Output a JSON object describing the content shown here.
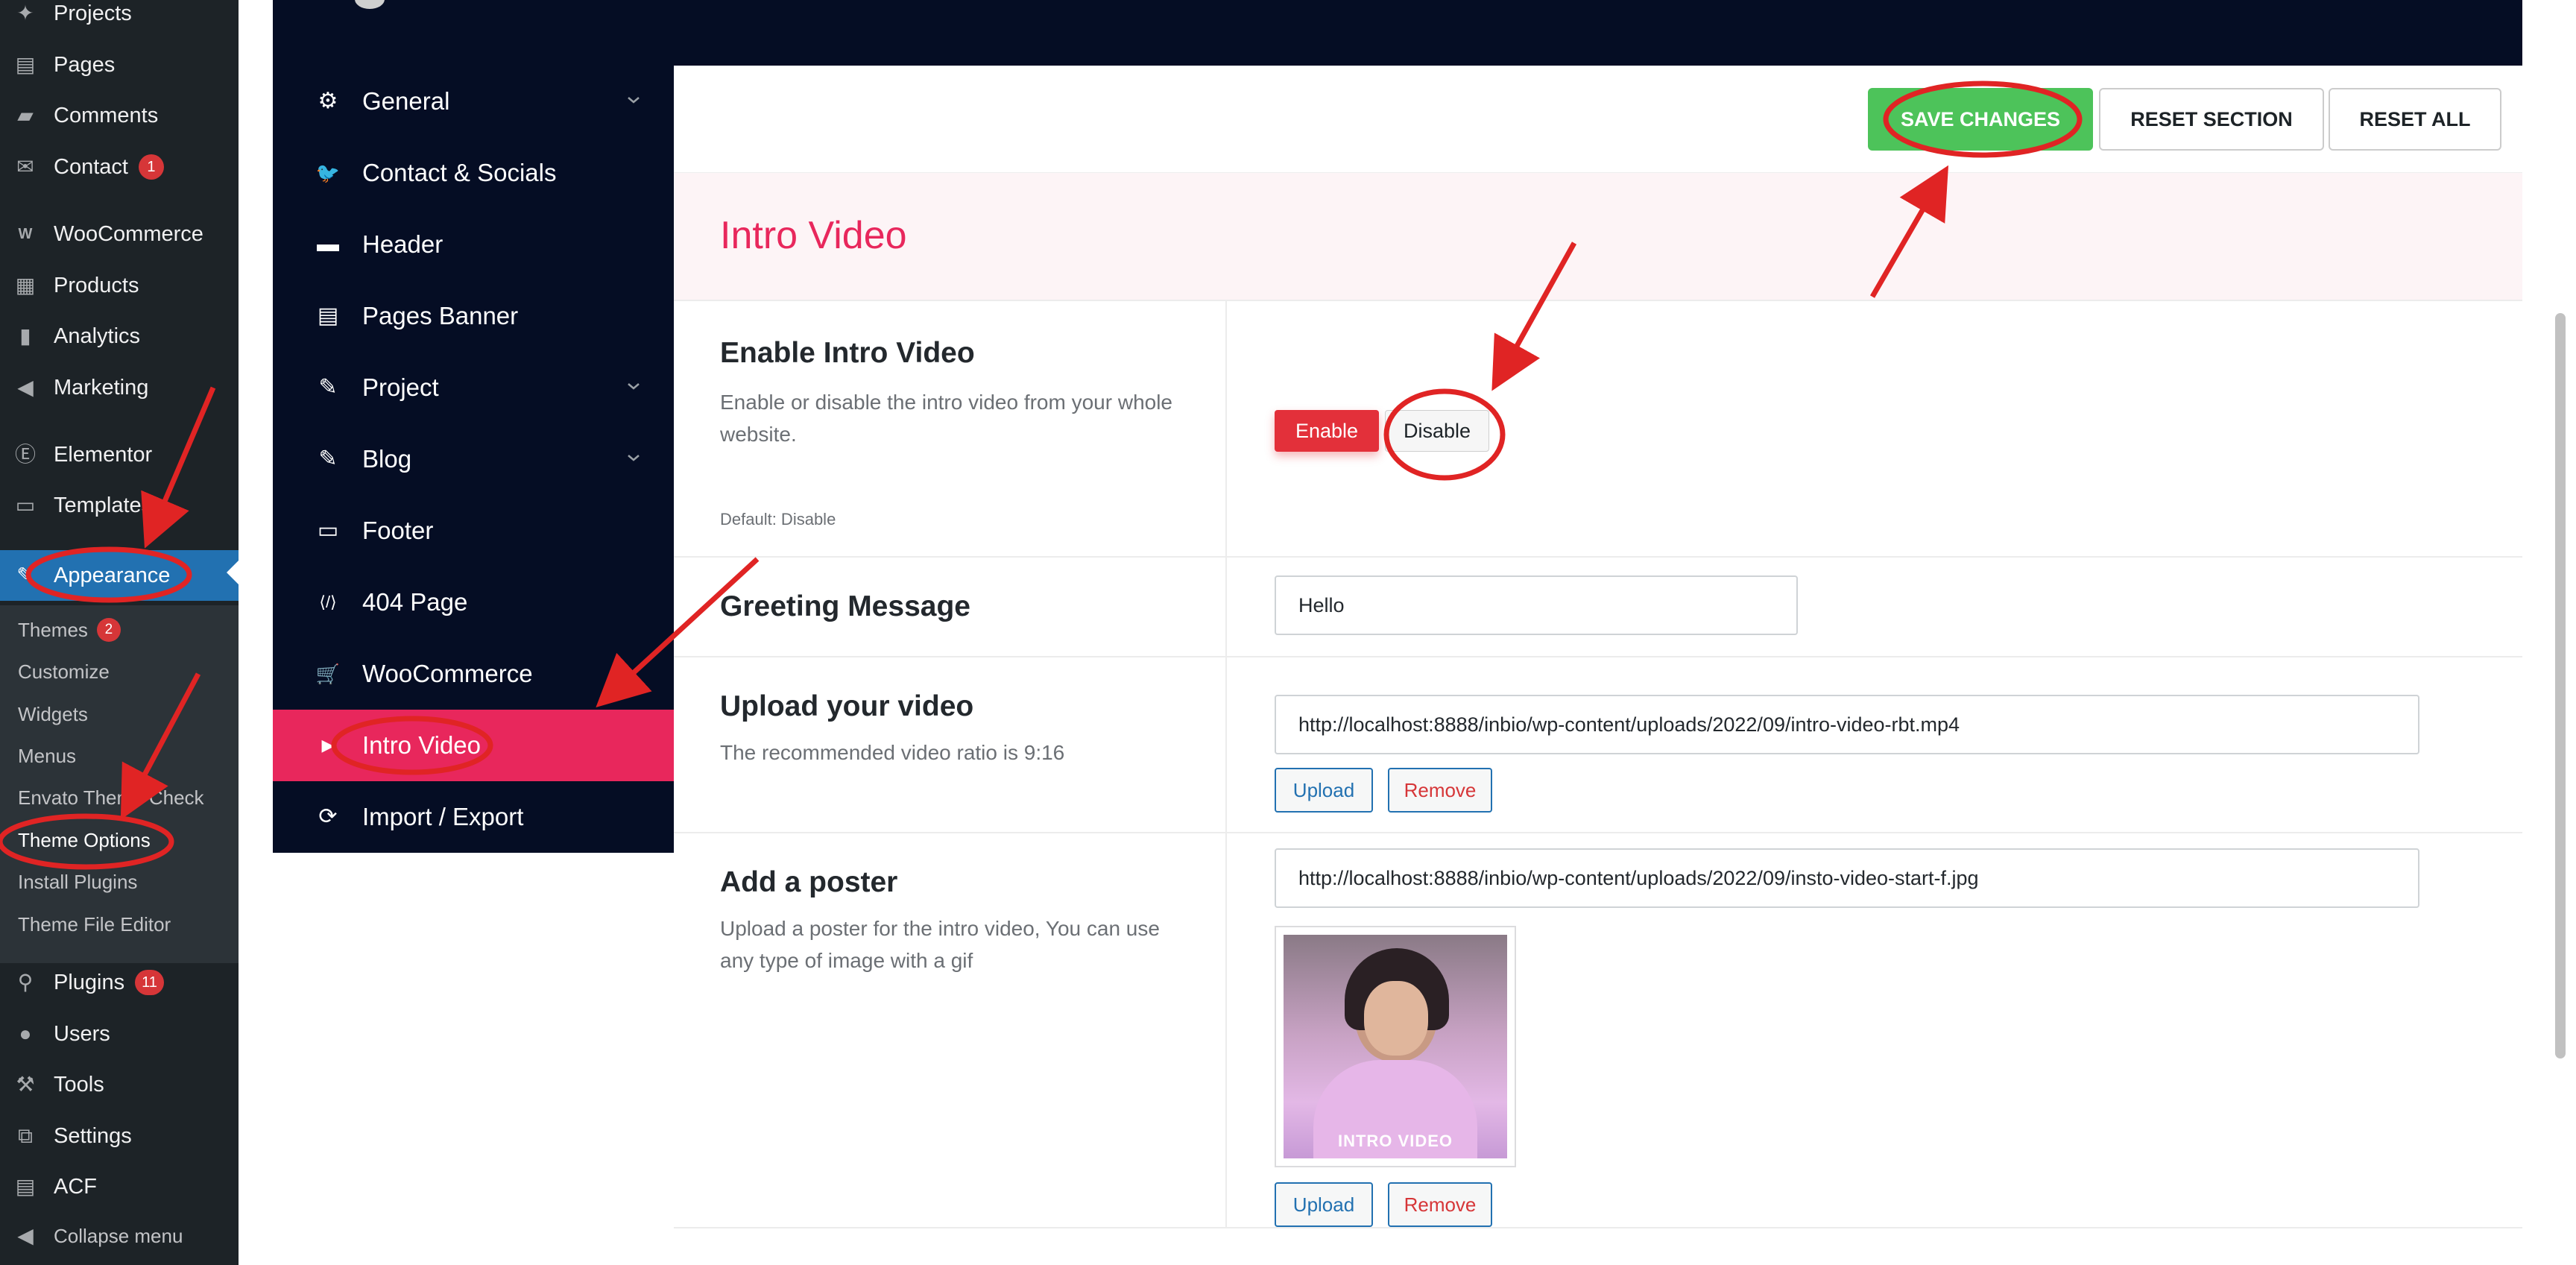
{
  "wp_sidebar": {
    "items": [
      {
        "label": "Projects",
        "icon": "projects-icon",
        "glyph": "✦",
        "badge": ""
      },
      {
        "label": "Pages",
        "icon": "pages-icon",
        "glyph": "▤",
        "badge": ""
      },
      {
        "label": "Comments",
        "icon": "comments-icon",
        "glyph": "▰",
        "badge": ""
      },
      {
        "label": "Contact",
        "icon": "contact-icon",
        "glyph": "✉",
        "badge": "1"
      },
      {
        "label": "WooCommerce",
        "icon": "woocommerce-icon",
        "glyph": "W",
        "badge": ""
      },
      {
        "label": "Products",
        "icon": "products-icon",
        "glyph": "▦",
        "badge": ""
      },
      {
        "label": "Analytics",
        "icon": "analytics-icon",
        "glyph": "▮",
        "badge": ""
      },
      {
        "label": "Marketing",
        "icon": "marketing-icon",
        "glyph": "◀",
        "badge": ""
      },
      {
        "label": "Elementor",
        "icon": "elementor-icon",
        "glyph": "Ⓔ",
        "badge": ""
      },
      {
        "label": "Templates",
        "icon": "templates-icon",
        "glyph": "▭",
        "badge": ""
      },
      {
        "label": "Appearance",
        "icon": "appearance-icon",
        "glyph": "✎",
        "badge": ""
      }
    ],
    "submenu": [
      {
        "label": "Themes",
        "badge": "2"
      },
      {
        "label": "Customize",
        "badge": ""
      },
      {
        "label": "Widgets",
        "badge": ""
      },
      {
        "label": "Menus",
        "badge": ""
      },
      {
        "label": "Envato Theme Check",
        "badge": ""
      },
      {
        "label": "Theme Options",
        "badge": ""
      },
      {
        "label": "Install Plugins",
        "badge": ""
      },
      {
        "label": "Theme File Editor",
        "badge": ""
      }
    ],
    "items_bottom": [
      {
        "label": "Plugins",
        "icon": "plugins-icon",
        "glyph": "⚲",
        "badge": "11"
      },
      {
        "label": "Users",
        "icon": "users-icon",
        "glyph": "●",
        "badge": ""
      },
      {
        "label": "Tools",
        "icon": "tools-icon",
        "glyph": "⚒",
        "badge": ""
      },
      {
        "label": "Settings",
        "icon": "settings-icon",
        "glyph": "⧉",
        "badge": ""
      },
      {
        "label": "ACF",
        "icon": "acf-icon",
        "glyph": "▤",
        "badge": ""
      }
    ],
    "collapse_label": "Collapse menu"
  },
  "options_nav": {
    "items": [
      {
        "label": "General",
        "icon": "gear-icon",
        "glyph": "⚙",
        "has_chevron": true
      },
      {
        "label": "Contact & Socials",
        "icon": "twitter-icon",
        "glyph": "🐦",
        "has_chevron": false
      },
      {
        "label": "Header",
        "icon": "header-icon",
        "glyph": "▬",
        "has_chevron": false
      },
      {
        "label": "Pages Banner",
        "icon": "banner-icon",
        "glyph": "▤",
        "has_chevron": false
      },
      {
        "label": "Project",
        "icon": "project-icon",
        "glyph": "✎",
        "has_chevron": true
      },
      {
        "label": "Blog",
        "icon": "blog-icon",
        "glyph": "✎",
        "has_chevron": true
      },
      {
        "label": "Footer",
        "icon": "footer-icon",
        "glyph": "▭",
        "has_chevron": false
      },
      {
        "label": "404 Page",
        "icon": "error-page-icon",
        "glyph": "⟨/⟩",
        "has_chevron": false
      },
      {
        "label": "WooCommerce",
        "icon": "cart-icon",
        "glyph": "🛒",
        "has_chevron": false
      },
      {
        "label": "Intro Video",
        "icon": "video-icon",
        "glyph": "▶",
        "has_chevron": false
      },
      {
        "label": "Import / Export",
        "icon": "refresh-icon",
        "glyph": "⟳",
        "has_chevron": false
      }
    ],
    "active_index": 9,
    "active_color": "#e8275c"
  },
  "toolbar": {
    "save_label": "SAVE CHANGES",
    "reset_section_label": "RESET SECTION",
    "reset_all_label": "RESET ALL",
    "save_color": "#4dc35a"
  },
  "section": {
    "title": "Intro Video",
    "title_color": "#e8275c"
  },
  "fields": {
    "enable_video": {
      "title": "Enable Intro Video",
      "description": "Enable or disable the intro video from your whole website.",
      "default_text": "Default: Disable",
      "enable_label": "Enable",
      "disable_label": "Disable"
    },
    "greeting": {
      "title": "Greeting Message",
      "value": "Hello"
    },
    "upload_video": {
      "title": "Upload your video",
      "description": "The recommended video ratio is 9:16",
      "url": "http://localhost:8888/inbio/wp-content/uploads/2022/09/intro-video-rbt.mp4",
      "upload_label": "Upload",
      "remove_label": "Remove"
    },
    "poster": {
      "title": "Add a poster",
      "description": "Upload a poster for the intro video, You can use any type of image with a gif",
      "url": "http://localhost:8888/inbio/wp-content/uploads/2022/09/insto-video-start-f.jpg",
      "preview_caption": "INTRO VIDEO",
      "upload_label": "Upload",
      "remove_label": "Remove"
    }
  },
  "annotation_color": "#e02424"
}
